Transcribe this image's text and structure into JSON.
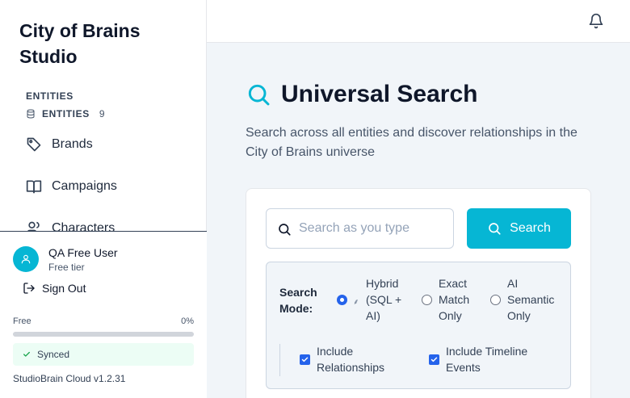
{
  "sidebar": {
    "brand": "City of Brains Studio",
    "section_label": "ENTITIES",
    "entities_label": "ENTITIES",
    "entities_count": "9",
    "nav": [
      {
        "label": "Brands",
        "icon": "tag-icon"
      },
      {
        "label": "Campaigns",
        "icon": "book-open-icon"
      },
      {
        "label": "Characters",
        "icon": "users-icon"
      }
    ],
    "user": {
      "name": "QA Free User",
      "tier": "Free tier"
    },
    "sign_out": "Sign Out",
    "plan": {
      "label": "Free",
      "percent_text": "0%",
      "usage_fraction": 0
    },
    "sync_status": "Synced",
    "version": "StudioBrain Cloud v1.2.31"
  },
  "main": {
    "title": "Universal Search",
    "description": "Search across all entities and discover relationships in the City of Brains universe",
    "search": {
      "placeholder": "Search as you type",
      "value": "",
      "button_label": "Search"
    },
    "search_mode": {
      "label": "Search Mode:",
      "options": [
        {
          "label": "Hybrid (SQL + AI)",
          "selected": true
        },
        {
          "label": "Exact Match Only",
          "selected": false
        },
        {
          "label": "AI Semantic Only",
          "selected": false
        }
      ]
    },
    "toggles": [
      {
        "label": "Include Relationships",
        "checked": true
      },
      {
        "label": "Include Timeline Events",
        "checked": true
      }
    ]
  },
  "colors": {
    "accent": "#06b6d4",
    "checked": "#2563eb"
  }
}
